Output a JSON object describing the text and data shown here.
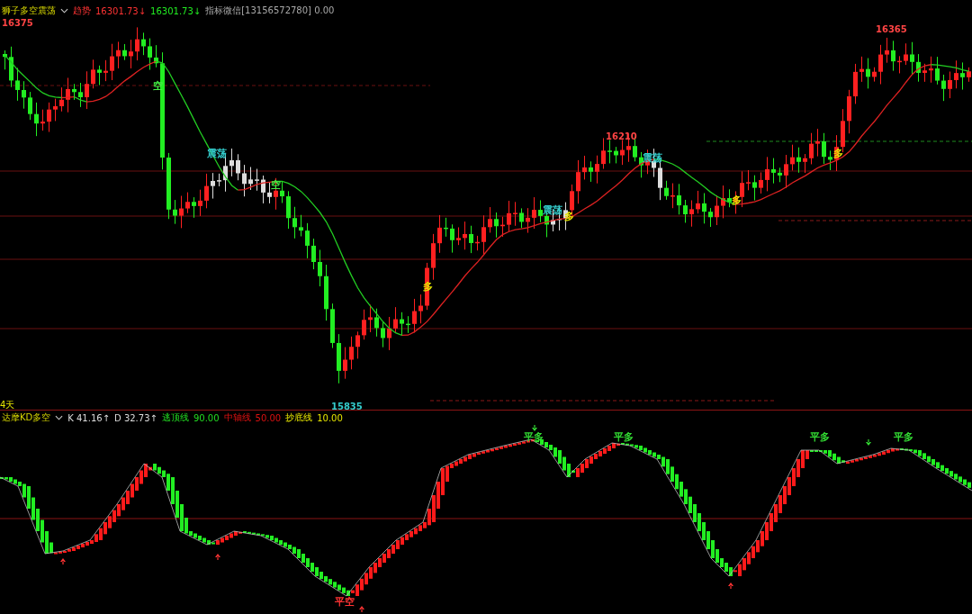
{
  "main_header": {
    "indicator": "狮子多空震荡",
    "trend_label": "趋势",
    "value_1": "16301.73↓",
    "value_2": "16301.73↓",
    "info": "指标微信[13156572780] 0.00"
  },
  "main_chart": {
    "labels": [
      {
        "text": "16375",
        "kind": "high"
      },
      {
        "text": "16210",
        "kind": "high"
      },
      {
        "text": "16365",
        "kind": "high"
      },
      {
        "text": "15835",
        "kind": "low"
      },
      {
        "text": "空",
        "kind": "short"
      },
      {
        "text": "空",
        "kind": "short"
      },
      {
        "text": "震荡",
        "kind": "range"
      },
      {
        "text": "震荡",
        "kind": "range"
      },
      {
        "text": "震荡",
        "kind": "range"
      },
      {
        "text": "多",
        "kind": "long"
      },
      {
        "text": "多",
        "kind": "long"
      },
      {
        "text": "多",
        "kind": "long"
      },
      {
        "text": "多",
        "kind": "long"
      }
    ],
    "period": "4天"
  },
  "sub_header": {
    "indicator": "达摩KD多空",
    "k": "K 41.16↑",
    "d": "D 32.73↑",
    "lines": [
      {
        "label": "逃顶线",
        "value": "90.00",
        "color": "#22dd22"
      },
      {
        "label": "中轴线",
        "value": "50.00",
        "color": "#dd1111"
      },
      {
        "label": "抄底线",
        "value": "10.00",
        "color": "#e6e600"
      }
    ]
  },
  "sub_chart": {
    "labels": [
      {
        "text": "平多",
        "kind": "close_long"
      },
      {
        "text": "平多",
        "kind": "close_long"
      },
      {
        "text": "平多",
        "kind": "close_long"
      },
      {
        "text": "平多",
        "kind": "close_long"
      },
      {
        "text": "平空",
        "kind": "close_short"
      }
    ]
  }
}
